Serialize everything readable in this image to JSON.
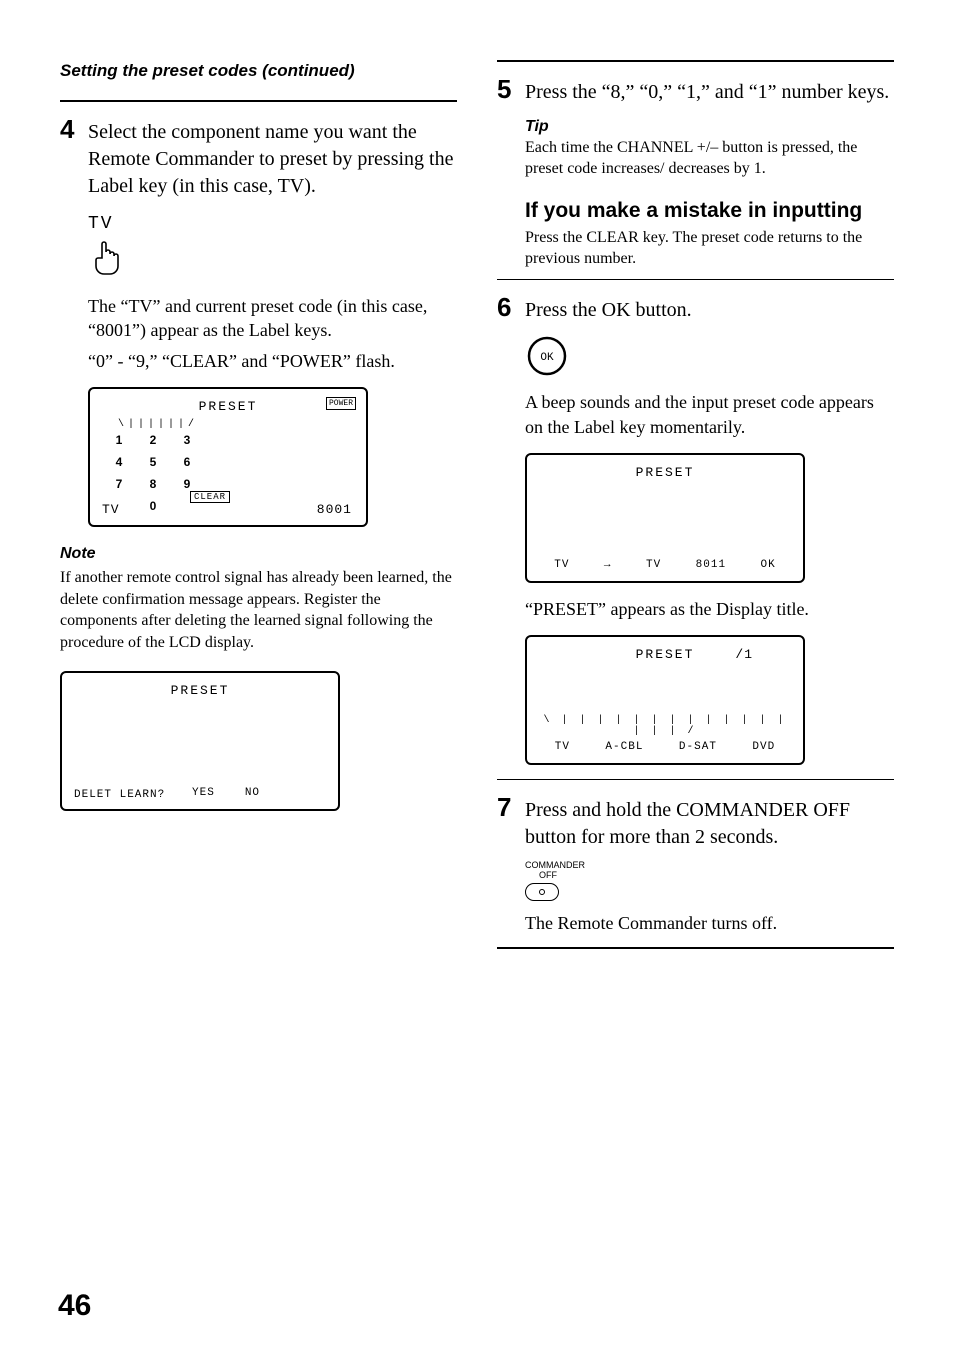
{
  "page_number": "46",
  "left": {
    "section_title": "Setting the preset codes (continued)",
    "step4": {
      "num": "4",
      "text": "Select the component name you want the Remote Commander to preset by pressing the Label key (in this case, TV).",
      "tv_label": "TV",
      "after1": "The “TV” and current preset code (in this case, “8001”) appear as the Label keys.",
      "after2": "“0” - “9,” “CLEAR” and “POWER” flash."
    },
    "lcd1": {
      "title": "PRESET",
      "power": "POWER",
      "digits": [
        "1",
        "2",
        "3",
        "4",
        "5",
        "6",
        "7",
        "8",
        "9",
        "",
        "0",
        ""
      ],
      "clear": "CLEAR",
      "bl": "TV",
      "br": "8001"
    },
    "note": {
      "heading": "Note",
      "text": "If another remote control signal has already been learned, the delete confirmation message appears. Register the components after deleting the learned signal following the procedure of the LCD display."
    },
    "lcd2": {
      "title": "PRESET",
      "bl": "DELET LEARN?",
      "yes": "YES",
      "no": "NO"
    }
  },
  "right": {
    "step5": {
      "num": "5",
      "text": "Press the “8,” “0,” “1,” and “1” number keys."
    },
    "tip": {
      "heading": "Tip",
      "text": "Each time the CHANNEL +/– button is pressed, the preset code increases/ decreases by 1."
    },
    "mistake": {
      "heading": "If you make a mistake in inputting",
      "text": "Press the CLEAR key. The preset code returns to the previous number."
    },
    "step6": {
      "num": "6",
      "text": "Press the OK button.",
      "ok_label": "OK",
      "after": "A beep sounds and the input preset code appears on the Label key momentarily."
    },
    "lcd3": {
      "title": "PRESET",
      "row": [
        "TV",
        "→",
        "TV",
        "8011",
        "OK"
      ]
    },
    "preset_appears": "“PRESET” appears as the Display title.",
    "lcd4": {
      "title": "PRESET",
      "side": "/1",
      "row": [
        "TV",
        "A-CBL",
        "D-SAT",
        "DVD"
      ]
    },
    "step7": {
      "num": "7",
      "text": "Press and hold the COMMANDER OFF button for more than 2 seconds.",
      "off_label1": "COMMANDER",
      "off_label2": "OFF",
      "after": "The Remote Commander turns off."
    }
  }
}
